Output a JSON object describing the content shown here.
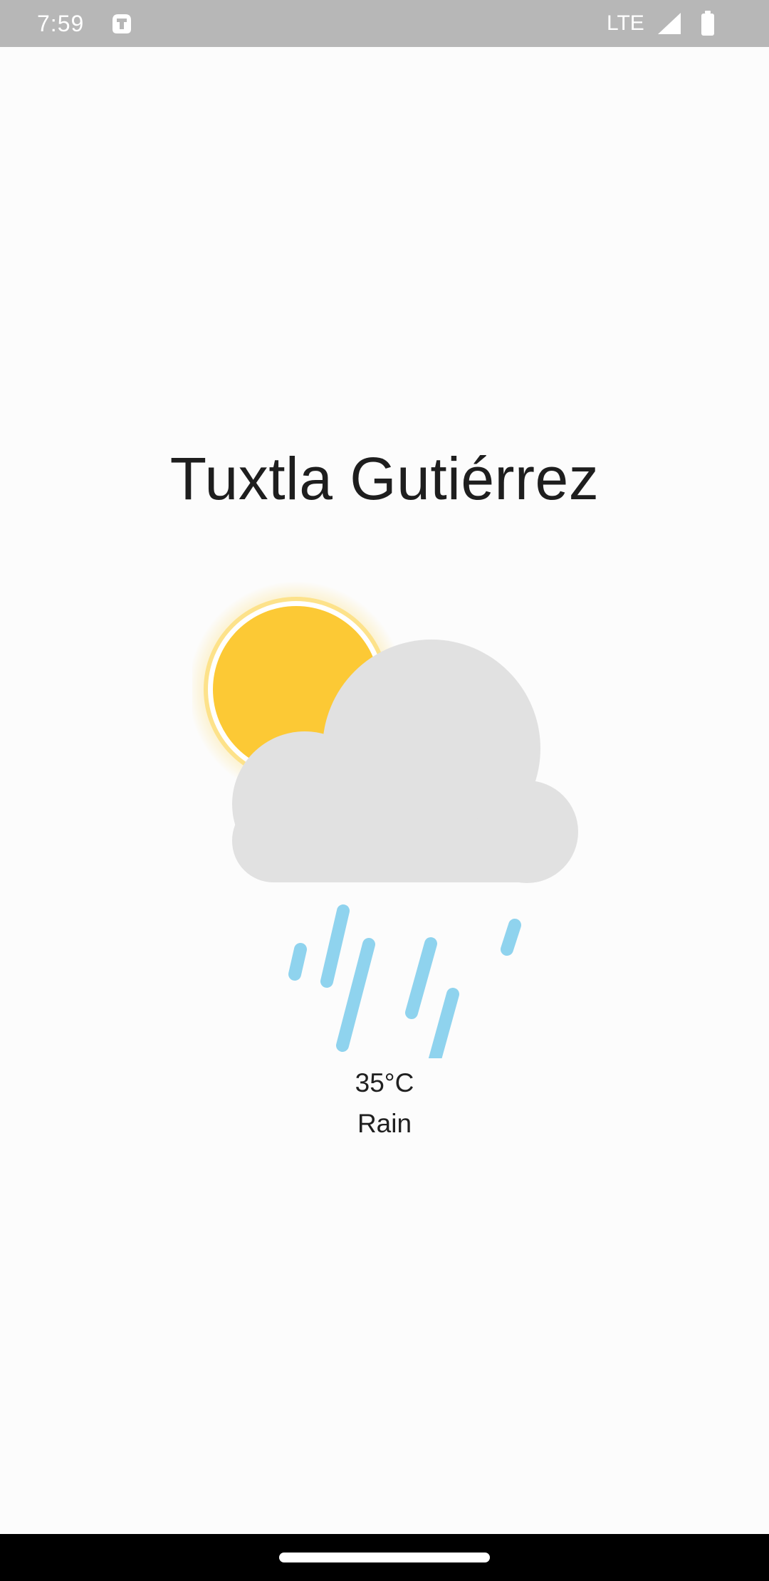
{
  "status_bar": {
    "time": "7:59",
    "network": "LTE",
    "app_icon": "android-icon",
    "signal_icon": "signal-icon",
    "battery_icon": "battery-icon"
  },
  "weather": {
    "city": "Tuxtla Gutiérrez",
    "temperature": "35°C",
    "condition": "Rain",
    "icon": "sun-cloud-rain-icon"
  },
  "navigation": {
    "home_handle": "home-gesture-handle"
  },
  "colors": {
    "status_bar": "#b7b7b7",
    "background": "#fcfcfc",
    "sun": "#fcc935",
    "sun_ring": "#fde28a",
    "cloud": "#e1e1e1",
    "rain": "#8fd3ee",
    "nav_bar": "#000000"
  }
}
